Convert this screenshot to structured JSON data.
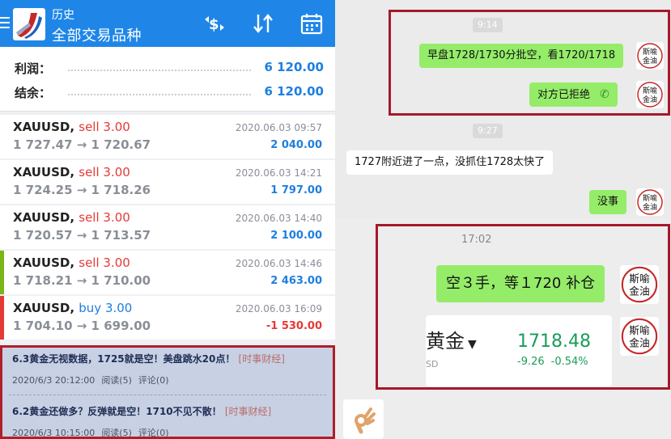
{
  "app": {
    "header_line1": "历史",
    "header_line2": "全部交易品种",
    "icons": [
      "menu-icon",
      "app-logo",
      "currency-swap-icon",
      "sort-icon",
      "calendar-icon"
    ]
  },
  "summary": {
    "profit_label": "利润：",
    "profit_value": "6 120.00",
    "balance_label": "结余：",
    "balance_value": "6 120.00"
  },
  "trades": [
    {
      "symbol": "XAUUSD,",
      "side": "sell 3.00",
      "side_type": "sell",
      "prices": "1 727.47 → 1 720.67",
      "time": "2020.06.03 09:57",
      "profit": "2 040.00",
      "profit_type": "pos",
      "bar_color": ""
    },
    {
      "symbol": "XAUUSD,",
      "side": "sell 3.00",
      "side_type": "sell",
      "prices": "1 724.25 → 1 718.26",
      "time": "2020.06.03 14:21",
      "profit": "1 797.00",
      "profit_type": "pos",
      "bar_color": ""
    },
    {
      "symbol": "XAUUSD,",
      "side": "sell 3.00",
      "side_type": "sell",
      "prices": "1 720.57 → 1 713.57",
      "time": "2020.06.03 14:40",
      "profit": "2 100.00",
      "profit_type": "pos",
      "bar_color": ""
    },
    {
      "symbol": "XAUUSD,",
      "side": "sell 3.00",
      "side_type": "sell",
      "prices": "1 718.21 → 1 710.00",
      "time": "2020.06.03 14:46",
      "profit": "2 463.00",
      "profit_type": "pos",
      "bar_color": "#7cb518"
    },
    {
      "symbol": "XAUUSD,",
      "side": "buy 3.00",
      "side_type": "buy",
      "prices": "1 704.10 → 1 699.00",
      "time": "2020.06.03 16:09",
      "profit": "-1 530.00",
      "profit_type": "neg",
      "bar_color": "#e53935"
    }
  ],
  "news": [
    {
      "title": "6.3黄金无视数据，1725就是空！美盘跳水20点！",
      "tag": "[时事财经]",
      "date": "2020/6/3 20:12:00",
      "reads": "阅读(5)",
      "comments": "评论(0)"
    },
    {
      "title": "6.2黄金还做多？反弹就是空！1710不见不散！",
      "tag": "[时事财经]",
      "date": "2020/6/3 10:15:00",
      "reads": "阅读(5)",
      "comments": "评论(0)"
    }
  ],
  "chat": {
    "time1": "9:14",
    "msg1": "早盘1728/1730分批空，看1720/1718",
    "msg2": "对方已拒绝",
    "time2": "9:27",
    "msg3": "1727附近进了一点，没抓住1728太快了",
    "msg4": "没事",
    "time3": "17:02",
    "msg5": "空３手，等１720 补仓",
    "card": {
      "name": "黄金",
      "sub": "SD",
      "price": "1718.48",
      "change": "-9.26",
      "change_pct": "-0.54%"
    },
    "avatar_text": [
      "斯",
      "喻",
      "金",
      "油"
    ],
    "emoji_icon": "ok-hand-icon"
  },
  "colors": {
    "header_blue": "#1f86e8",
    "value_blue": "#1e7fe0",
    "loss_red": "#e53935",
    "wechat_green": "#95ec69",
    "highlight_red": "#a5192a"
  }
}
